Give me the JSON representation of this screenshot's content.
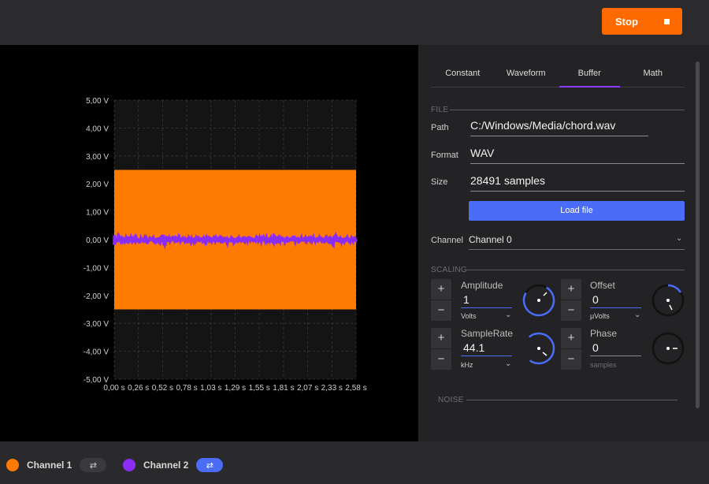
{
  "toolbar": {
    "stop_label": "Stop"
  },
  "tabs": [
    {
      "label": "Constant",
      "active": false
    },
    {
      "label": "Waveform",
      "active": false
    },
    {
      "label": "Buffer",
      "active": true
    },
    {
      "label": "Math",
      "active": false
    }
  ],
  "file": {
    "section_label": "FILE",
    "path_label": "Path",
    "path_value": "C:/Windows/Media/chord.wav",
    "format_label": "Format",
    "format_value": "WAV",
    "size_label": "Size",
    "size_value": "28491 samples",
    "load_button": "Load file",
    "channel_label": "Channel",
    "channel_value": "Channel 0"
  },
  "scaling": {
    "section_label": "SCALING",
    "amplitude": {
      "label": "Amplitude",
      "value": "1",
      "unit": "Volts"
    },
    "offset": {
      "label": "Offset",
      "value": "0",
      "unit": "µVolts"
    },
    "samplerate": {
      "label": "SampleRate",
      "value": "44.1",
      "unit": "kHz"
    },
    "phase": {
      "label": "Phase",
      "value": "0",
      "unit": "samples"
    },
    "plus": "+",
    "minus": "−"
  },
  "noise": {
    "section_label": "NOISE"
  },
  "channels": [
    {
      "name": "Channel 1",
      "color": "#ff7a00",
      "toggle_active": false
    },
    {
      "name": "Channel 2",
      "color": "#8b2cf5",
      "toggle_active": true
    }
  ],
  "colors": {
    "accent": "#ff6a00",
    "primary_blue": "#4a6cf7",
    "purple": "#8b3dff"
  },
  "chart_data": {
    "type": "line",
    "ylim": [
      -5,
      5
    ],
    "xlim": [
      0,
      2.58
    ],
    "y_ticks": [
      "5,00 V",
      "4,00 V",
      "3,00 V",
      "2,00 V",
      "1,00 V",
      "0,00 V",
      "-1,00 V",
      "-2,00 V",
      "-3,00 V",
      "-4,00 V",
      "-5,00 V"
    ],
    "x_ticks": [
      "0,00 s",
      "0,26 s",
      "0,52 s",
      "0,78 s",
      "1,03 s",
      "1,29 s",
      "1,55 s",
      "1,81 s",
      "2,07 s",
      "2,33 s",
      "2,58 s"
    ],
    "grid": true,
    "series": [
      {
        "color": "#ff7a00",
        "band": [
          -2.5,
          2.5
        ]
      },
      {
        "color": "#8b2cf5",
        "level": 0.0,
        "bursts_at": [
          0.0,
          0.52,
          1.17,
          1.72,
          2.33
        ]
      }
    ]
  }
}
